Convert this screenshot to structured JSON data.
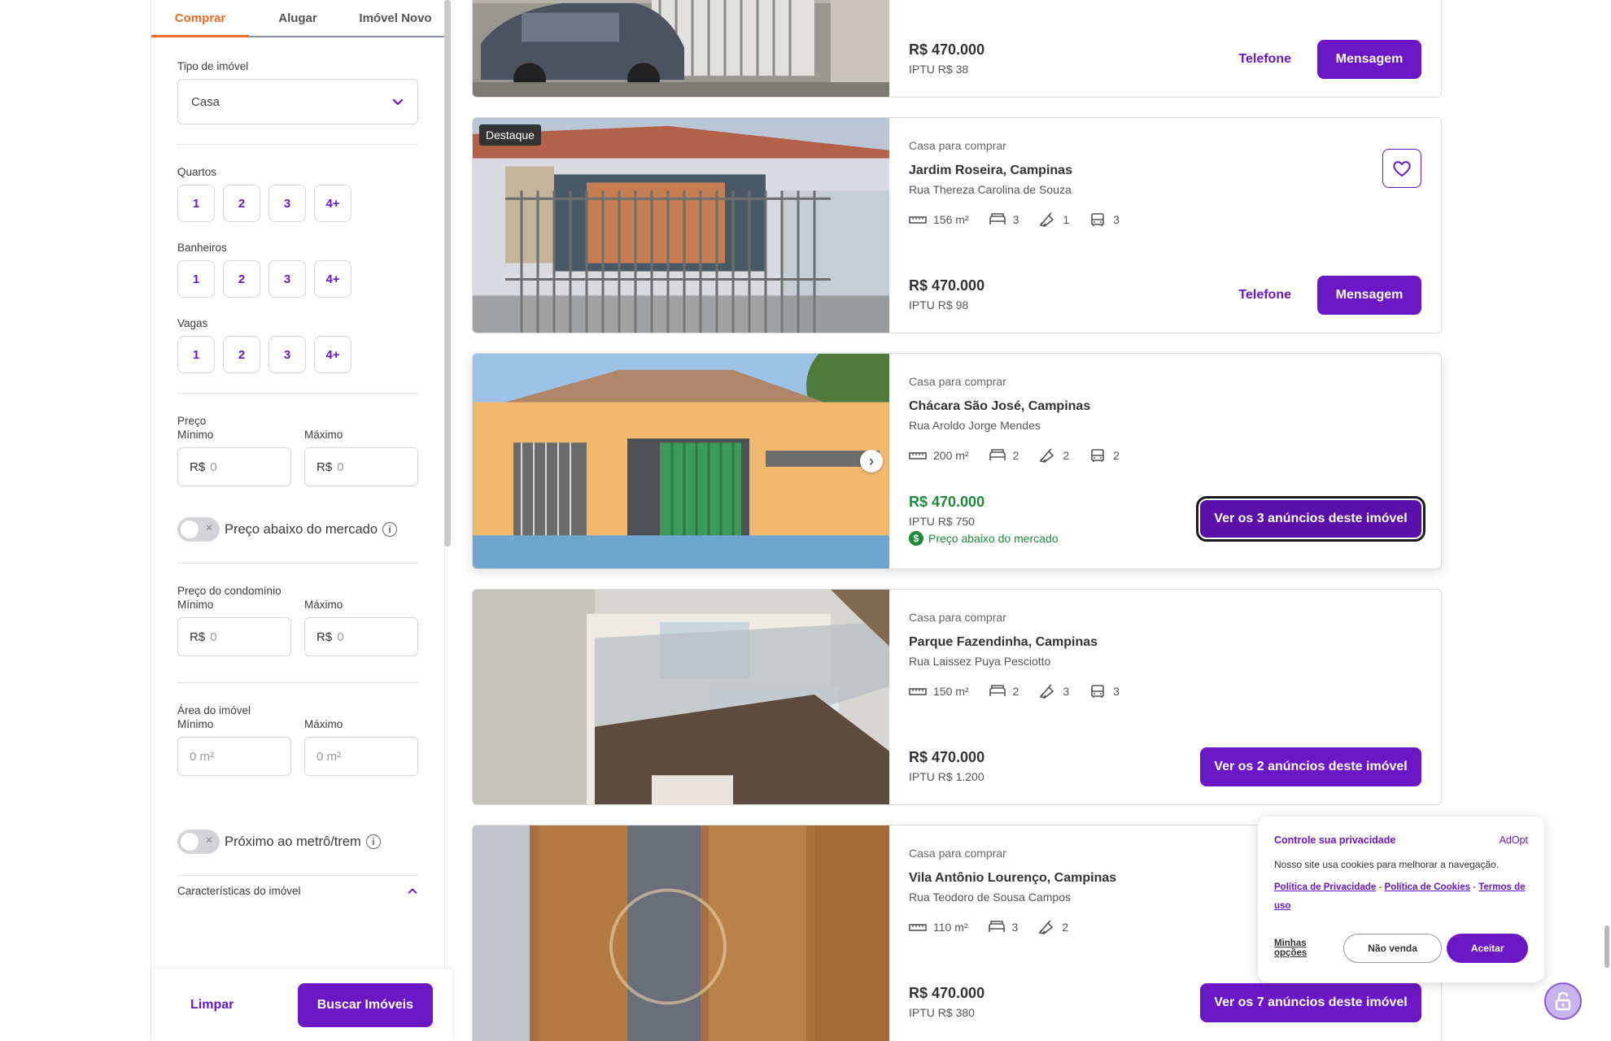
{
  "sidebar": {
    "tabs": [
      {
        "label": "Comprar",
        "active": true
      },
      {
        "label": "Alugar",
        "active": false
      },
      {
        "label": "Imóvel Novo",
        "active": false
      }
    ],
    "tipo_label": "Tipo de imóvel",
    "tipo_value": "Casa",
    "quartos_label": "Quartos",
    "banheiros_label": "Banheiros",
    "vagas_label": "Vagas",
    "counts": [
      "1",
      "2",
      "3",
      "4+"
    ],
    "preco_label": "Preço",
    "min_label": "Mínimo",
    "max_label": "Máximo",
    "currency": "R$",
    "money_placeholder": "0",
    "preco_abaixo_label": "Preço abaixo do mercado",
    "condominio_label": "Preço do condomínio",
    "area_label": "Área do imóvel",
    "area_placeholder": "0 m²",
    "metro_label": "Próximo ao metrô/trem",
    "caracteristicas_label": "Características do imóvel",
    "limpar_label": "Limpar",
    "buscar_label": "Buscar Imóveis"
  },
  "listings": [
    {
      "price": "R$ 470.000",
      "iptu": "IPTU R$ 38",
      "phone_label": "Telefone",
      "message_label": "Mensagem"
    },
    {
      "badge": "Destaque",
      "type": "Casa para comprar",
      "neighborhood": "Jardim Roseira, Campinas",
      "street": "Rua Thereza Carolina de Souza",
      "area": "156 m²",
      "bedrooms": "3",
      "bathrooms": "1",
      "parking": "3",
      "price": "R$ 470.000",
      "iptu": "IPTU R$ 98",
      "phone_label": "Telefone",
      "message_label": "Mensagem"
    },
    {
      "type": "Casa para comprar",
      "neighborhood": "Chácara São José, Campinas",
      "street": "Rua Aroldo Jorge Mendes",
      "area": "200 m²",
      "bedrooms": "2",
      "bathrooms": "2",
      "parking": "2",
      "price": "R$ 470.000",
      "iptu": "IPTU R$ 750",
      "below_market": "Preço abaixo do mercado",
      "cta": "Ver os 3 anúncios deste imóvel",
      "price_color": "#1f8a3b"
    },
    {
      "type": "Casa para comprar",
      "neighborhood": "Parque Fazendinha, Campinas",
      "street": "Rua Laissez Puya Pesciotto",
      "area": "150 m²",
      "bedrooms": "2",
      "bathrooms": "3",
      "parking": "3",
      "price": "R$ 470.000",
      "iptu": "IPTU R$ 1.200",
      "cta": "Ver os 2 anúncios deste imóvel"
    },
    {
      "type": "Casa para comprar",
      "neighborhood": "Vila Antônio Lourenço, Campinas",
      "street": "Rua Teodoro de Sousa Campos",
      "area": "110 m²",
      "bedrooms": "3",
      "bathrooms": "2",
      "price": "R$ 470.000",
      "iptu": "IPTU R$ 380",
      "cta": "Ver os 7 anúncios deste imóvel"
    }
  ],
  "cookie": {
    "title": "Controle sua privacidade",
    "brand": "AdOpt",
    "text": "Nosso site usa cookies para melhorar a navegação.",
    "privacy_link": "Política de Privacidade",
    "cookies_link": "Política de Cookies",
    "terms_link": "Termos de uso",
    "sep": "-",
    "options_label": "Minhas opções",
    "reject_label": "Não venda",
    "accept_label": "Aceitar"
  },
  "colors": {
    "accent": "#6b17c5",
    "active_tab": "#f06a22",
    "below_market": "#1f8a3b"
  }
}
